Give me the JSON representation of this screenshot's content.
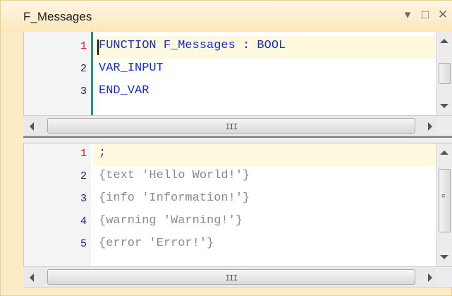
{
  "window": {
    "title": "F_Messages",
    "controls": [
      {
        "name": "dropdown",
        "glyph": "▾"
      },
      {
        "name": "maximize",
        "glyph": "□"
      },
      {
        "name": "close",
        "glyph": "✕"
      }
    ]
  },
  "declaration_pane": {
    "lines": [
      {
        "number": "1",
        "text": "FUNCTION F_Messages : BOOL"
      },
      {
        "number": "2",
        "text": "VAR_INPUT"
      },
      {
        "number": "3",
        "text": "END_VAR"
      }
    ]
  },
  "implementation_pane": {
    "lines": [
      {
        "number": "1",
        "text": ";"
      },
      {
        "number": "2",
        "text": "{text 'Hello World!'}"
      },
      {
        "number": "3",
        "text": "{info 'Information!'}"
      },
      {
        "number": "4",
        "text": "{warning 'Warning!'}"
      },
      {
        "number": "5",
        "text": "{error 'Error!'}"
      }
    ]
  },
  "scrollbar_grip": "III",
  "colors": {
    "keyword": "#1a2fc4",
    "pragma": "#8c8c8c",
    "line_number_top": "#b01010",
    "line_number_bottom": "#1a1a6e",
    "first_line_number": "#d12020",
    "current_line_bg": "#fff9df"
  }
}
